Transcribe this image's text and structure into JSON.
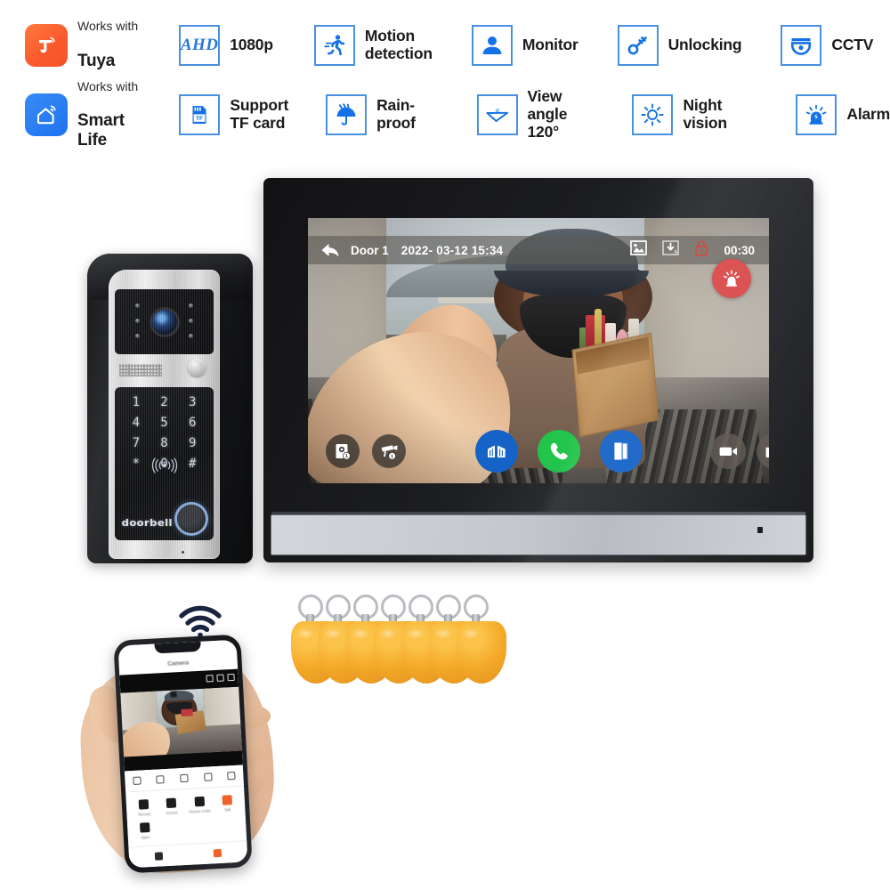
{
  "features": {
    "row1": [
      {
        "id": "tuya",
        "icon": "tuya-logo",
        "pre": "Works with",
        "name": "Tuya",
        "type": "logo"
      },
      {
        "id": "ahd",
        "icon": "ahd-badge-icon",
        "badge": "AHD",
        "label": "1080p",
        "type": "box"
      },
      {
        "id": "motion",
        "icon": "running-person-icon",
        "label": "Motion\ndetection",
        "type": "box"
      },
      {
        "id": "monitor",
        "icon": "person-icon",
        "label": "Monitor",
        "type": "box"
      },
      {
        "id": "unlocking",
        "icon": "key-icon",
        "label": "Unlocking",
        "type": "box"
      },
      {
        "id": "cctv",
        "icon": "dome-camera-icon",
        "label": "CCTV",
        "type": "box"
      }
    ],
    "row2": [
      {
        "id": "smartlife",
        "icon": "smart-life-logo",
        "pre": "Works with",
        "name": "Smart Life",
        "type": "logo"
      },
      {
        "id": "tfcard",
        "icon": "tf-card-icon",
        "label": "Support\nTF card",
        "type": "box"
      },
      {
        "id": "rainproof",
        "icon": "umbrella-rain-icon",
        "label": "Rain-proof",
        "type": "box"
      },
      {
        "id": "viewangle",
        "icon": "view-angle-icon",
        "label": "View angle\n120°",
        "type": "box"
      },
      {
        "id": "nightvision",
        "icon": "sun-icon",
        "label": "Night vision",
        "type": "box"
      },
      {
        "id": "alarm",
        "icon": "siren-icon",
        "label": "Alarm",
        "type": "box"
      }
    ]
  },
  "door_station": {
    "brand": "doorbell",
    "keys": [
      "1",
      "2",
      "3",
      "4",
      "5",
      "6",
      "7",
      "8",
      "9",
      "*",
      "0",
      "#"
    ],
    "rfid_icon": "rfid-wave-icon",
    "camera_icon": "camera-lens-icon",
    "speaker_icon": "speaker-grille-icon",
    "fingerprint_icon": "fingerprint-button-icon",
    "call_button_icon": "call-button-icon"
  },
  "monitor": {
    "statusbar": {
      "back_icon": "back-arrow-icon",
      "channel": "Door 1",
      "datetime": "2022- 03-12 15:34",
      "icons": [
        "picture-icon",
        "auto-download-icon",
        "lock-icon"
      ],
      "timer": "00:30"
    },
    "alarm_button_icon": "siren-alarm-icon",
    "controls": [
      {
        "id": "door-station",
        "icon": "door-station-camera-icon",
        "badge": "1",
        "style": "dark"
      },
      {
        "id": "cctv",
        "icon": "cctv-camera-icon",
        "badge": "1",
        "style": "dark"
      },
      {
        "id": "gate",
        "icon": "gate-open-icon",
        "style": "blue"
      },
      {
        "id": "talk",
        "icon": "phone-handset-icon",
        "style": "green"
      },
      {
        "id": "unlock-door",
        "icon": "door-unlock-icon",
        "style": "blue"
      },
      {
        "id": "record",
        "icon": "camcorder-icon",
        "style": "gray"
      },
      {
        "id": "snapshot",
        "icon": "photo-camera-icon",
        "style": "gray"
      }
    ]
  },
  "fobs": {
    "count": 7,
    "color": "#f4a929",
    "name": "rfid-key-fob"
  },
  "phone": {
    "wifi_icon": "wifi-icon",
    "app_title": "Camera",
    "toolbar_icons": [
      "fullscreen-icon",
      "resolution-icon",
      "mute-icon",
      "rotate-icon",
      "more-icon"
    ],
    "actions": [
      {
        "icon": "record-icon",
        "label": "Record"
      },
      {
        "icon": "screenshot-icon",
        "label": "Screen"
      },
      {
        "icon": "palette-icon",
        "label": "Picture Color"
      },
      {
        "icon": "talk-icon",
        "label": "Talk",
        "accent": true
      },
      {
        "icon": "lock-icon",
        "label": "Open"
      }
    ],
    "tabs": [
      {
        "icon": "playback-icon",
        "active": false
      },
      {
        "icon": "settings-icon",
        "active": true
      }
    ]
  },
  "colors": {
    "badge_border": "#4a90e2",
    "icon_blue": "#1472e6",
    "tuya_orange": "#fb5a2d",
    "smartlife_blue": "#1d73ef",
    "alarm_red": "#d94b4b",
    "talk_green": "#22c44b",
    "button_blue": "#1663c7",
    "fob_orange": "#f4a929",
    "background": "#ffffff"
  }
}
